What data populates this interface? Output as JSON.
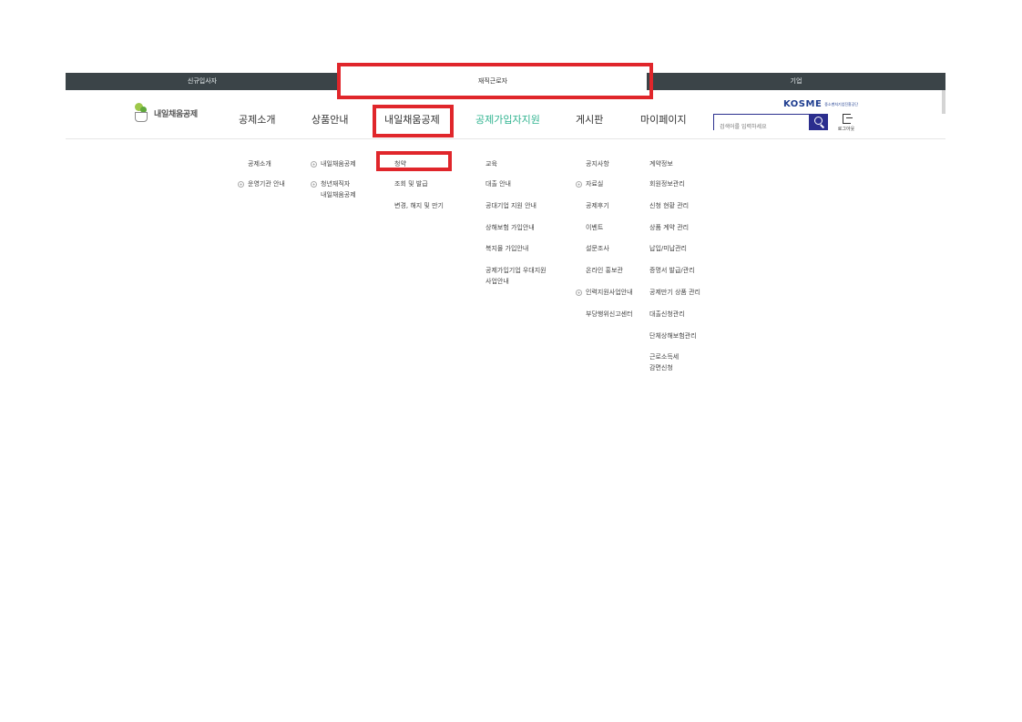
{
  "topbar": {
    "tabs": [
      {
        "label": "신규입사자"
      },
      {
        "label": "재직근로자"
      },
      {
        "label": "기업"
      }
    ]
  },
  "header": {
    "logo_text": "내일채움공제",
    "gnb": [
      {
        "label": "공제소개"
      },
      {
        "label": "상품안내"
      },
      {
        "label": "내일채움공제"
      },
      {
        "label": "공제가입자지원"
      },
      {
        "label": "게시판"
      },
      {
        "label": "마이페이지"
      }
    ],
    "kosme_text": "KOSME",
    "kosme_sub": "중소벤처기업진흥공단",
    "search_placeholder": "검색어를 입력하세요",
    "logout_label": "로그아웃"
  },
  "submenu": {
    "col1": [
      "공제소개",
      "운영기관 안내"
    ],
    "col2": [
      "내일채움공제",
      "청년재직자",
      "내일채움공제"
    ],
    "col3": [
      "청약",
      "조회 및 발급",
      "변경, 해지 및 만기"
    ],
    "col4": [
      "교육",
      "대출 안내",
      "공대기업 지원 안내",
      "상해보험 가입안내",
      "복지몰 가입안내",
      "공제가입기업 우대지원",
      "사업안내"
    ],
    "col5": [
      "공지사항",
      "자료실",
      "공제후기",
      "이벤트",
      "설문조사",
      "온라인 홍보관",
      "인력지원사업안내",
      "부당행위신고센터"
    ],
    "col6": [
      "계약정보",
      "회원정보관리",
      "신청 현황 관리",
      "상품 계약 관리",
      "납입/미납관리",
      "증명서 발급/관리",
      "공제만기 상품 관리",
      "대출신청관리",
      "단체상해보험관리",
      "근로소득세",
      "감면신청"
    ]
  },
  "colors": {
    "topbar_bg": "#3b4448",
    "highlight": "#e0262b",
    "accent_green": "#2fb38f",
    "kosme_blue": "#1d3c8f"
  }
}
